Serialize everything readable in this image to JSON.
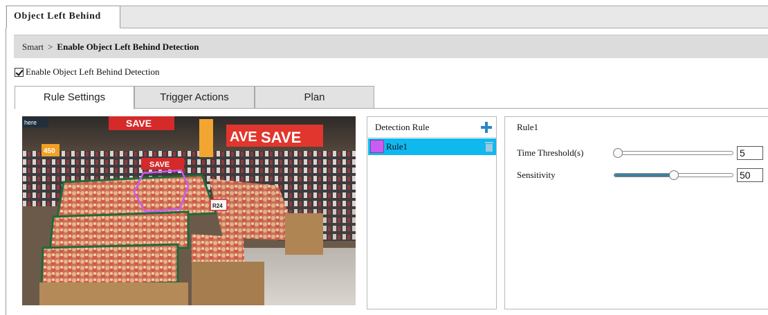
{
  "window": {
    "tab_title": "Object Left Behind"
  },
  "breadcrumb": {
    "root": "Smart",
    "separator": ">",
    "current": "Enable Object Left Behind Detection"
  },
  "enable_checkbox": {
    "label": "Enable Object Left Behind Detection",
    "checked": true
  },
  "tabs": [
    {
      "label": "Rule Settings",
      "active": true
    },
    {
      "label": "Trigger Actions",
      "active": false
    },
    {
      "label": "Plan",
      "active": false
    }
  ],
  "video": {
    "overlay_text": [
      "here",
      "SAVE",
      "SAVE",
      "AVE",
      "SAVE",
      "SAVE",
      "450",
      "R24"
    ]
  },
  "detection_rule_panel": {
    "header": "Detection Rule",
    "add_icon": "plus-icon",
    "rules": [
      {
        "label": "Rule1",
        "color": "#c95cf3",
        "selected": true
      }
    ],
    "delete_icon": "trash-icon"
  },
  "rule_detail": {
    "title": "Rule1",
    "time_threshold": {
      "label": "Time Threshold(s)",
      "value": "5",
      "slider_fraction": 0.03
    },
    "sensitivity": {
      "label": "Sensitivity",
      "value": "50",
      "slider_fraction": 0.5
    }
  },
  "colors": {
    "selected_row": "#10b8f0",
    "rule_color": "#c95cf3",
    "accent_icon": "#2a86c8",
    "slider_fill": "#3f7f9e"
  }
}
